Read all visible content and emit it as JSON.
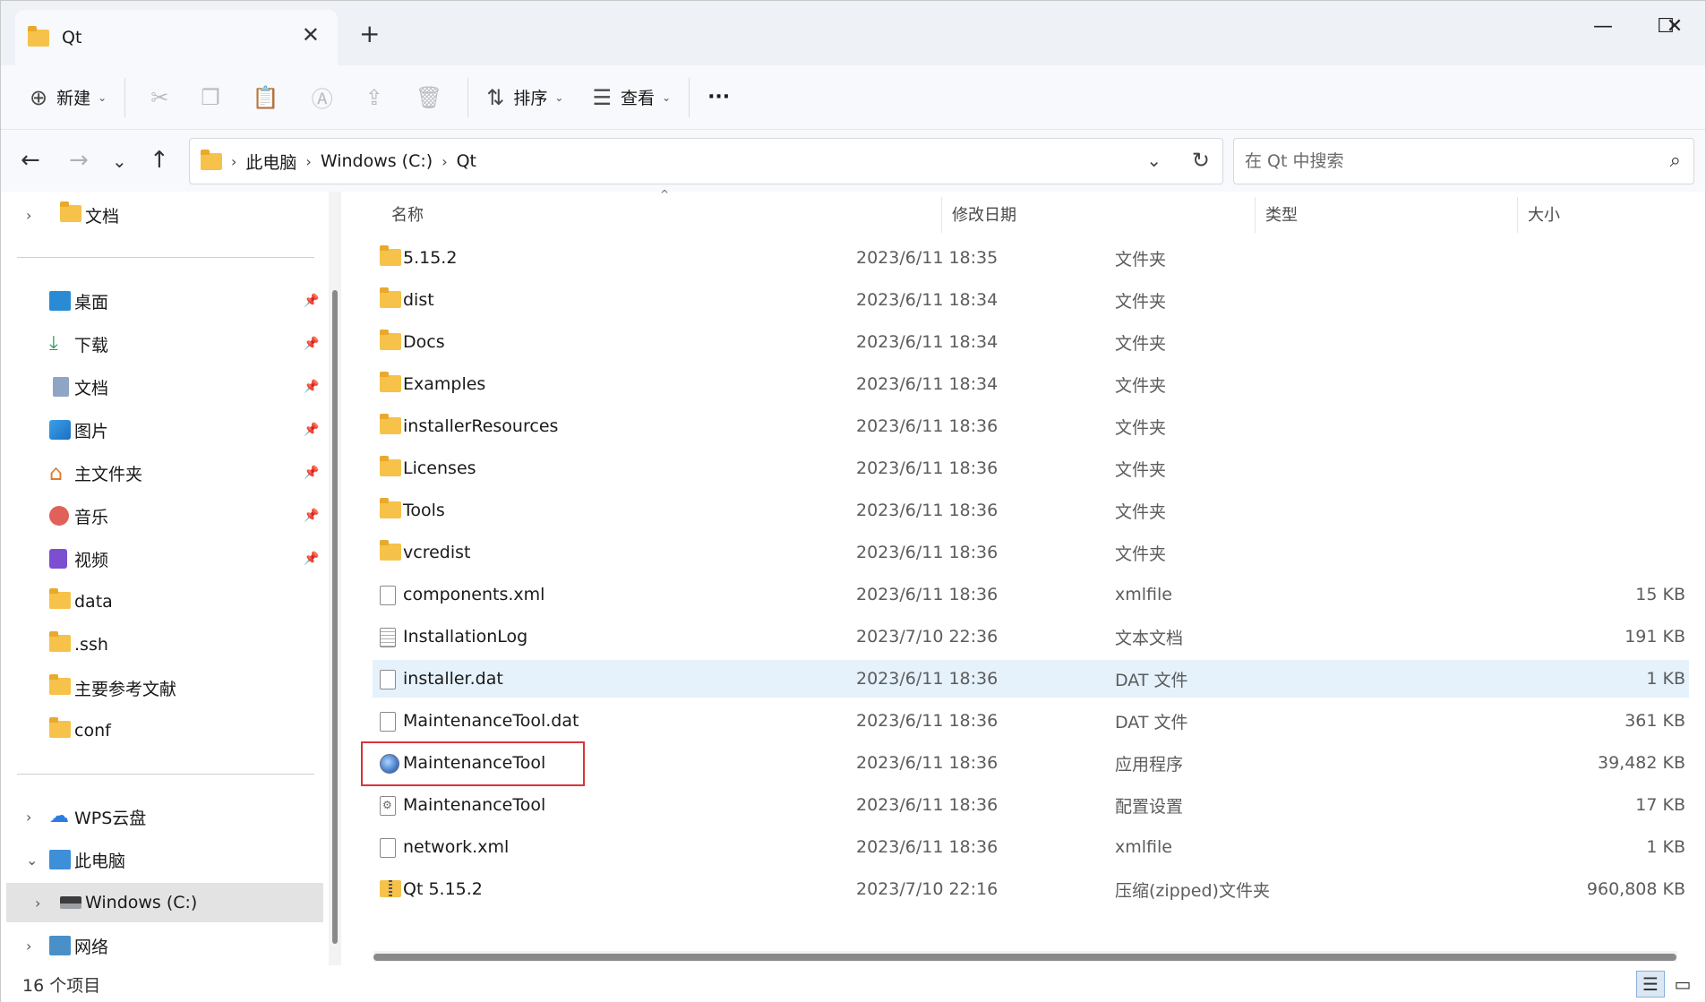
{
  "window": {
    "tab_title": "Qt",
    "tab_close_icon": "close-icon",
    "new_tab_symbol": "+",
    "minimize_symbol": "—",
    "maximize_symbol": "☐",
    "close_symbol": "✕"
  },
  "toolbar": {
    "new_label": "新建",
    "sort_label": "排序",
    "view_label": "查看",
    "more_symbol": "···"
  },
  "address": {
    "crumbs": [
      "此电脑",
      "Windows (C:)",
      "Qt"
    ],
    "search_placeholder": "在 Qt 中搜索"
  },
  "sidebar": {
    "items": [
      {
        "label": "文档",
        "icon": "folder-icon"
      },
      {
        "label": "桌面",
        "icon": "desktop-icon"
      },
      {
        "label": "下载",
        "icon": "download-icon"
      },
      {
        "label": "文档",
        "icon": "documents-icon"
      },
      {
        "label": "图片",
        "icon": "pictures-icon"
      },
      {
        "label": "主文件夹",
        "icon": "home-icon"
      },
      {
        "label": "音乐",
        "icon": "music-icon"
      },
      {
        "label": "视频",
        "icon": "video-icon"
      },
      {
        "label": "data",
        "icon": "folder-icon"
      },
      {
        "label": ".ssh",
        "icon": "folder-icon"
      },
      {
        "label": "主要参考文献",
        "icon": "folder-icon"
      },
      {
        "label": "conf",
        "icon": "folder-icon"
      },
      {
        "label": "WPS云盘",
        "icon": "cloud-icon"
      },
      {
        "label": "此电脑",
        "icon": "computer-icon"
      },
      {
        "label": "Windows (C:)",
        "icon": "drive-icon"
      },
      {
        "label": "网络",
        "icon": "network-icon"
      }
    ]
  },
  "columns": {
    "name": "名称",
    "date": "修改日期",
    "type": "类型",
    "size": "大小"
  },
  "files": [
    {
      "name": "5.15.2",
      "date": "2023/6/11 18:35",
      "type": "文件夹",
      "size": "",
      "icon": "folder-icon"
    },
    {
      "name": "dist",
      "date": "2023/6/11 18:34",
      "type": "文件夹",
      "size": "",
      "icon": "folder-icon"
    },
    {
      "name": "Docs",
      "date": "2023/6/11 18:34",
      "type": "文件夹",
      "size": "",
      "icon": "folder-icon"
    },
    {
      "name": "Examples",
      "date": "2023/6/11 18:34",
      "type": "文件夹",
      "size": "",
      "icon": "folder-icon"
    },
    {
      "name": "installerResources",
      "date": "2023/6/11 18:36",
      "type": "文件夹",
      "size": "",
      "icon": "folder-icon"
    },
    {
      "name": "Licenses",
      "date": "2023/6/11 18:36",
      "type": "文件夹",
      "size": "",
      "icon": "folder-icon"
    },
    {
      "name": "Tools",
      "date": "2023/6/11 18:36",
      "type": "文件夹",
      "size": "",
      "icon": "folder-icon"
    },
    {
      "name": "vcredist",
      "date": "2023/6/11 18:36",
      "type": "文件夹",
      "size": "",
      "icon": "folder-icon"
    },
    {
      "name": "components.xml",
      "date": "2023/6/11 18:36",
      "type": "xmlfile",
      "size": "15 KB",
      "icon": "file-icon"
    },
    {
      "name": "InstallationLog",
      "date": "2023/7/10 22:36",
      "type": "文本文档",
      "size": "191 KB",
      "icon": "text-file-icon"
    },
    {
      "name": "installer.dat",
      "date": "2023/6/11 18:36",
      "type": "DAT 文件",
      "size": "1 KB",
      "icon": "file-icon"
    },
    {
      "name": "MaintenanceTool.dat",
      "date": "2023/6/11 18:36",
      "type": "DAT 文件",
      "size": "361 KB",
      "icon": "file-icon"
    },
    {
      "name": "MaintenanceTool",
      "date": "2023/6/11 18:36",
      "type": "应用程序",
      "size": "39,482 KB",
      "icon": "application-icon"
    },
    {
      "name": "MaintenanceTool",
      "date": "2023/6/11 18:36",
      "type": "配置设置",
      "size": "17 KB",
      "icon": "config-file-icon"
    },
    {
      "name": "network.xml",
      "date": "2023/6/11 18:36",
      "type": "xmlfile",
      "size": "1 KB",
      "icon": "file-icon"
    },
    {
      "name": "Qt 5.15.2",
      "date": "2023/7/10 22:16",
      "type": "压缩(zipped)文件夹",
      "size": "960,808 KB",
      "icon": "zip-folder-icon"
    }
  ],
  "status": {
    "count": "16 个项目"
  },
  "colors": {
    "selected_row": "#e5f1fb",
    "highlight_box": "#d9343b",
    "folder": "#f6c24a"
  }
}
